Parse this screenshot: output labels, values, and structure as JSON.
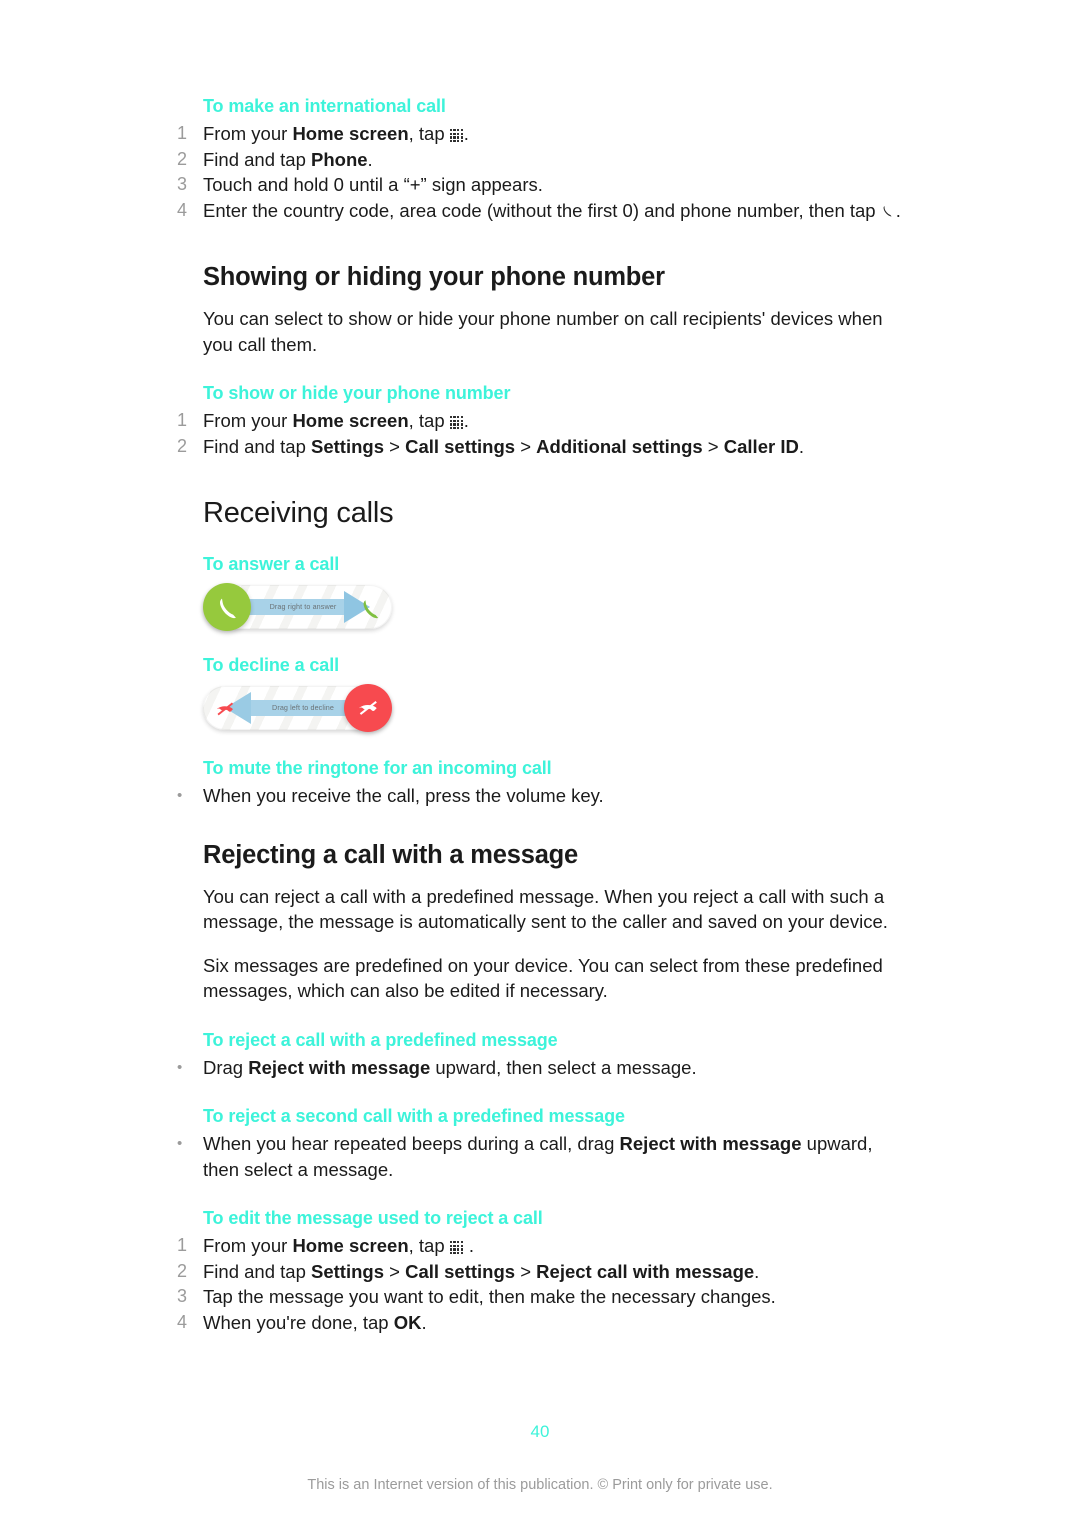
{
  "document": {
    "page_number": "40",
    "footer_note": "This is an Internet version of this publication. © Print only for private use.",
    "heading_color": "#3df3da",
    "text_color": "#1b1b1b",
    "marker_color": "#9b9b9b"
  },
  "sections": {
    "international_call": {
      "heading": "To make an international call",
      "steps": [
        {
          "num": "1",
          "pre": "From your ",
          "bold": "Home screen",
          "post": ", tap ",
          "icon": "app-drawer-grid-icon",
          "tail": "."
        },
        {
          "num": "2",
          "pre": "Find and tap ",
          "bold": "Phone",
          "post": ".",
          "icon": "",
          "tail": ""
        },
        {
          "num": "3",
          "pre": "Touch and hold 0 until a “+” sign appears.",
          "bold": "",
          "post": "",
          "icon": "",
          "tail": ""
        },
        {
          "num": "4",
          "pre": "Enter the country code, area code (without the first 0) and phone number, then tap ",
          "bold": "",
          "post": "",
          "icon": "phone-handset-icon",
          "tail": "."
        }
      ]
    },
    "showing_hiding": {
      "title": "Showing or hiding your phone number",
      "paragraph": "You can select to show or hide your phone number on call recipients' devices when you call them.",
      "heading": "To show or hide your phone number",
      "steps": [
        {
          "num": "1",
          "pre": "From your ",
          "bold": "Home screen",
          "post": ", tap ",
          "icon": "app-drawer-grid-icon",
          "tail": "."
        },
        {
          "num": "2",
          "pre": "Find and tap ",
          "bold": "Settings",
          "mid1": " > ",
          "bold2": "Call settings",
          "mid2": " > ",
          "bold3": "Additional settings",
          "mid3": " > ",
          "bold4": "Caller ID",
          "post": "."
        }
      ]
    },
    "receiving_calls": {
      "title": "Receiving calls",
      "answer": {
        "heading": "To answer a call",
        "widget_label": "Drag right to answer",
        "knob_color": "#96c93d",
        "arrow_color": "#a8d2e8",
        "left_icon": "phone-answer-icon",
        "right_icon": "phone-answer-icon"
      },
      "decline": {
        "heading": "To decline a call",
        "widget_label": "Drag left to decline",
        "knob_color": "#f74a4f",
        "arrow_color": "#a8d2e8",
        "left_icon": "phone-decline-icon",
        "right_icon": "phone-decline-icon"
      },
      "mute": {
        "heading": "To mute the ringtone for an incoming call",
        "bullet": "When you receive the call, press the volume key."
      }
    },
    "rejecting": {
      "title": "Rejecting a call with a message",
      "paragraph1": "You can reject a call with a predefined message. When you reject a call with such a message, the message is automatically sent to the caller and saved on your device.",
      "paragraph2": "Six messages are predefined on your device. You can select from these predefined messages, which can also be edited if necessary.",
      "reject_predefined": {
        "heading": "To reject a call with a predefined message",
        "bullet_pre": "Drag ",
        "bullet_bold": "Reject with message",
        "bullet_post": " upward, then select a message."
      },
      "reject_second": {
        "heading": "To reject a second call with a predefined message",
        "bullet_pre": "When you hear repeated beeps during a call, drag ",
        "bullet_bold": "Reject with message",
        "bullet_post": " upward, then select a message."
      },
      "edit_message": {
        "heading": "To edit the message used to reject a call",
        "steps": [
          {
            "num": "1",
            "pre": "From your ",
            "bold": "Home screen",
            "post": ", tap ",
            "icon": "app-drawer-grid-icon",
            "tail": " ."
          },
          {
            "num": "2",
            "pre": "Find and tap ",
            "bold": "Settings",
            "mid1": " > ",
            "bold2": "Call settings",
            "mid2": " > ",
            "bold3": "Reject call with message",
            "post": "."
          },
          {
            "num": "3",
            "pre": "Tap the message you want to edit, then make the necessary changes.",
            "bold": "",
            "post": ""
          },
          {
            "num": "4",
            "pre": "When you're done, tap ",
            "bold": "OK",
            "post": "."
          }
        ]
      }
    }
  }
}
